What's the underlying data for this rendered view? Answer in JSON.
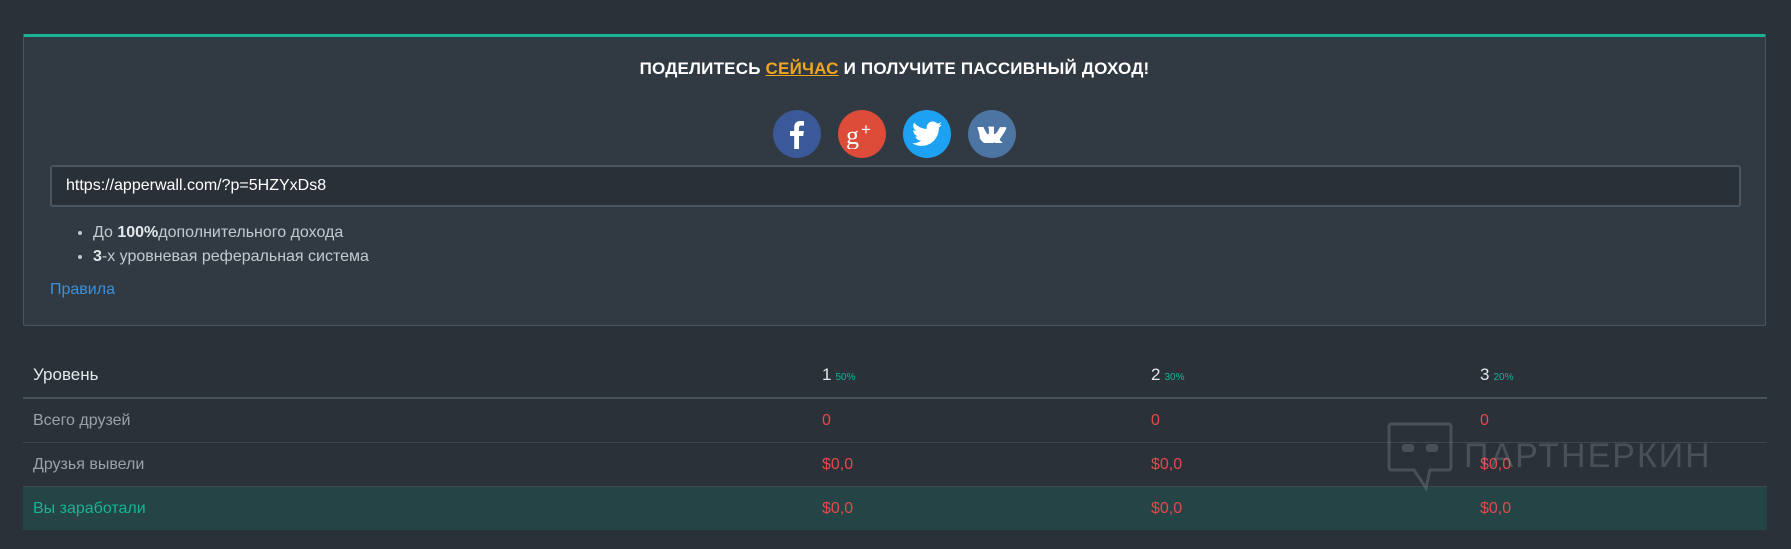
{
  "share": {
    "headline_before": "ПОДЕЛИТЕСЬ ",
    "headline_link": "СЕЙЧАС",
    "headline_after": " И ПОЛУЧИТЕ ПАССИВНЫЙ ДОХОД!",
    "link_color": "#f0a51e"
  },
  "socials": [
    {
      "name": "facebook",
      "icon": "facebook-icon",
      "color": "#3b5998"
    },
    {
      "name": "google-plus",
      "icon": "google-plus-icon",
      "color": "#dd4b39"
    },
    {
      "name": "twitter",
      "icon": "twitter-icon",
      "color": "#1da1f2"
    },
    {
      "name": "vk",
      "icon": "vk-icon",
      "color": "#4c75a3"
    }
  ],
  "referral_url": "https://apperwall.com/?p=5HZYxDs8",
  "benefits": [
    {
      "prefix": "До ",
      "bold": "100%",
      "suffix": "дополнительного дохода"
    },
    {
      "prefix": "",
      "bold": "3",
      "suffix": "-х уровневая реферальная система"
    }
  ],
  "rules_label": "Правила",
  "table": {
    "header": {
      "label": "Уровень",
      "levels": [
        {
          "level": "1",
          "percent": "50%"
        },
        {
          "level": "2",
          "percent": "30%"
        },
        {
          "level": "3",
          "percent": "20%"
        }
      ]
    },
    "rows": [
      {
        "label": "Всего друзей",
        "values": [
          "0",
          "0",
          "0"
        ]
      },
      {
        "label": "Друзья вывели",
        "values": [
          "$0,0",
          "$0,0",
          "$0,0"
        ]
      },
      {
        "label": "Вы заработали",
        "values": [
          "$0,0",
          "$0,0",
          "$0,0"
        ]
      }
    ]
  },
  "watermark": "ПАРТНЕРКИН",
  "accent_color": "#19b394",
  "value_color": "#e2494d"
}
